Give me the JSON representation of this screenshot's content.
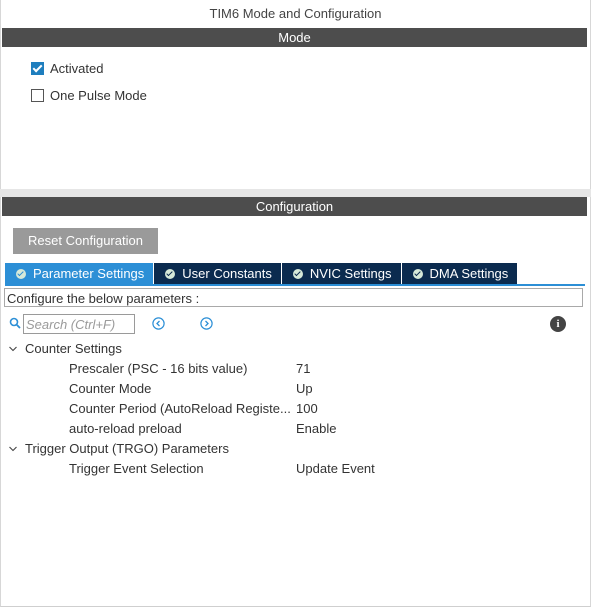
{
  "window": {
    "title": "TIM6 Mode and Configuration"
  },
  "mode": {
    "header": "Mode",
    "options": [
      {
        "label": "Activated",
        "checked": true
      },
      {
        "label": "One Pulse Mode",
        "checked": false
      }
    ]
  },
  "configuration": {
    "header": "Configuration",
    "reset_label": "Reset Configuration",
    "tabs": [
      {
        "label": "Parameter Settings",
        "active": true
      },
      {
        "label": "User Constants",
        "active": false
      },
      {
        "label": "NVIC Settings",
        "active": false
      },
      {
        "label": "DMA Settings",
        "active": false
      }
    ],
    "description": "Configure the below parameters :",
    "search": {
      "placeholder": "Search (Ctrl+F)",
      "value": ""
    },
    "icons": {
      "search": "search-icon",
      "prev": "arrow-left-circle-icon",
      "next": "arrow-right-circle-icon",
      "info": "info-icon"
    },
    "groups": [
      {
        "title": "Counter Settings",
        "params": [
          {
            "name": "Prescaler (PSC - 16 bits value)",
            "value": "71"
          },
          {
            "name": "Counter Mode",
            "value": "Up"
          },
          {
            "name": "Counter Period (AutoReload Registe...",
            "value": "100"
          },
          {
            "name": "auto-reload preload",
            "value": "Enable"
          }
        ]
      },
      {
        "title": "Trigger Output (TRGO) Parameters",
        "params": [
          {
            "name": "Trigger Event Selection",
            "value": "Update Event"
          }
        ]
      }
    ]
  },
  "colors": {
    "header_bar": "#4d4d4d",
    "tab_active": "#2c8fd6",
    "tab_inactive": "#0b2b4f",
    "checkbox_checked": "#1e7ebe",
    "button": "#9a9a9a"
  }
}
